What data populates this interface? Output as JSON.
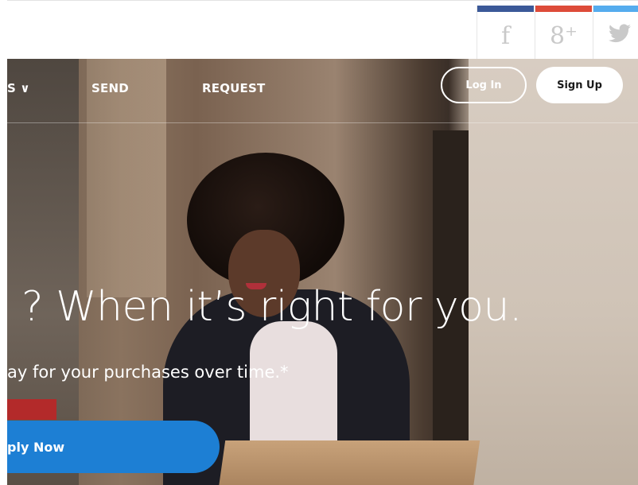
{
  "social": {
    "facebook": {
      "glyph": "f",
      "accent": "#3b5998"
    },
    "google_plus": {
      "glyph": "8⁺",
      "accent": "#dd4b39"
    },
    "twitter": {
      "glyph": "🐦",
      "accent": "#55acee"
    }
  },
  "nav": {
    "prev_label": "S ∨",
    "send_label": "SEND",
    "request_label": "REQUEST",
    "login_label": "Log In",
    "signup_label": "Sign Up"
  },
  "hero": {
    "headline": "? When it’s right for you.",
    "subline": "ay for your purchases over time.*",
    "cta_label": "ply Now",
    "cta_color": "#1d7fd4"
  }
}
